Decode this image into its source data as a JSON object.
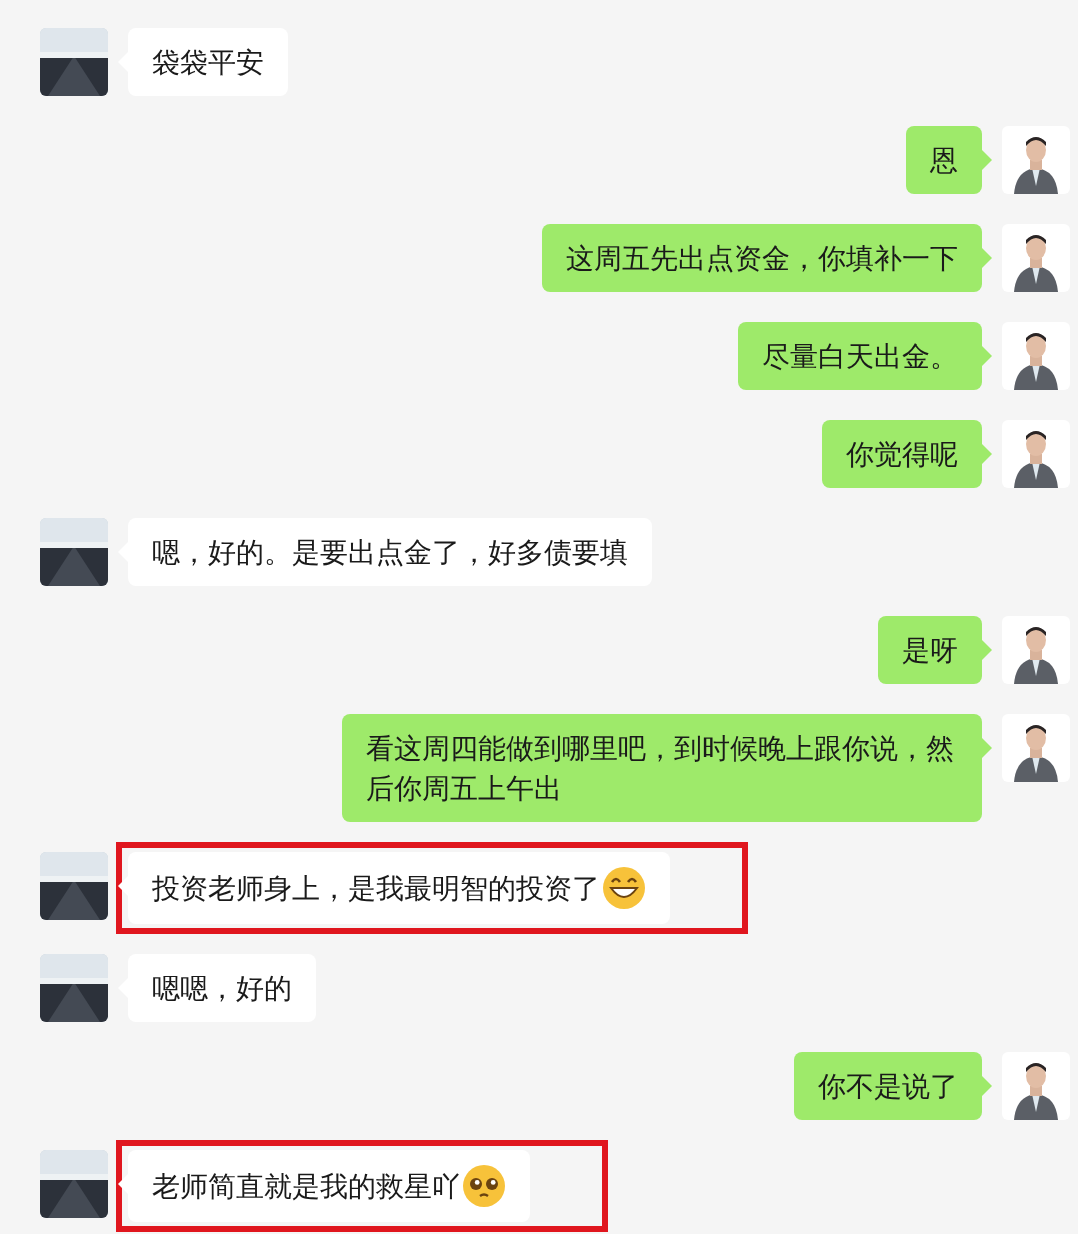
{
  "messages": [
    {
      "outgoing": false,
      "kind": "plain",
      "text": "袋袋平安",
      "highlighted": false
    },
    {
      "outgoing": true,
      "kind": "plain",
      "text": "恩",
      "highlighted": false
    },
    {
      "outgoing": true,
      "kind": "plain",
      "text": "这周五先出点资金，你填补一下",
      "highlighted": false
    },
    {
      "outgoing": true,
      "kind": "plain",
      "text": "尽量白天出金。",
      "highlighted": false
    },
    {
      "outgoing": true,
      "kind": "plain",
      "text": "你觉得呢",
      "highlighted": false
    },
    {
      "outgoing": false,
      "kind": "plain",
      "text": "嗯，好的。是要出点金了，好多债要填",
      "highlighted": false
    },
    {
      "outgoing": true,
      "kind": "plain",
      "text": "是呀",
      "highlighted": false
    },
    {
      "outgoing": true,
      "kind": "plain",
      "text": "看这周四能做到哪里吧，到时候晚上跟你说，然后你周五上午出",
      "highlighted": false
    },
    {
      "outgoing": false,
      "kind": "grin",
      "text": "投资老师身上，是我最明智的投资了",
      "highlighted": true
    },
    {
      "outgoing": false,
      "kind": "plain",
      "text": "嗯嗯，好的",
      "highlighted": false
    },
    {
      "outgoing": true,
      "kind": "plain",
      "text": "你不是说了",
      "highlighted": false
    },
    {
      "outgoing": false,
      "kind": "pleading",
      "text": "老师简直就是我的救星吖",
      "highlighted": true
    }
  ]
}
